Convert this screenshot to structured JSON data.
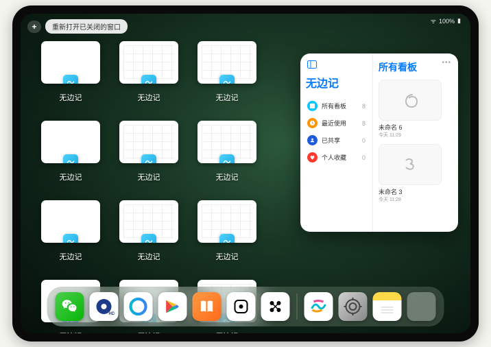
{
  "status": {
    "signal": "●●●●",
    "battery": "100%"
  },
  "topbar": {
    "add": "+",
    "reopen": "重新打开已关闭的窗口"
  },
  "app_name": "无边记",
  "thumbs": [
    {
      "label": "无边记",
      "layout": "blank"
    },
    {
      "label": "无边记",
      "layout": "grid"
    },
    {
      "label": "无边记",
      "layout": "grid"
    },
    {
      "label": "无边记",
      "layout": "blank"
    },
    {
      "label": "无边记",
      "layout": "grid"
    },
    {
      "label": "无边记",
      "layout": "grid"
    },
    {
      "label": "无边记",
      "layout": "blank"
    },
    {
      "label": "无边记",
      "layout": "grid"
    },
    {
      "label": "无边记",
      "layout": "grid"
    },
    {
      "label": "无边记",
      "layout": "blank"
    },
    {
      "label": "无边记",
      "layout": "blank"
    },
    {
      "label": "无边记",
      "layout": "grid"
    }
  ],
  "panel": {
    "title": "无边记",
    "right_title": "所有看板",
    "cats": [
      {
        "label": "所有看板",
        "count": "8",
        "color": "blue"
      },
      {
        "label": "最近使用",
        "count": "8",
        "color": "orange"
      },
      {
        "label": "已共享",
        "count": "0",
        "color": "darkblue"
      },
      {
        "label": "个人收藏",
        "count": "0",
        "color": "red"
      }
    ],
    "boards": [
      {
        "name": "未命名 6",
        "date": "今天 11:29",
        "shape": "6"
      },
      {
        "name": "未命名 3",
        "date": "今天 11:28",
        "shape": "3"
      }
    ]
  },
  "dock": {
    "apps": [
      "wechat",
      "quark",
      "qqbrowser",
      "play",
      "books",
      "game",
      "dots"
    ],
    "recent": [
      "freeform",
      "settings",
      "notes",
      "folder"
    ]
  }
}
